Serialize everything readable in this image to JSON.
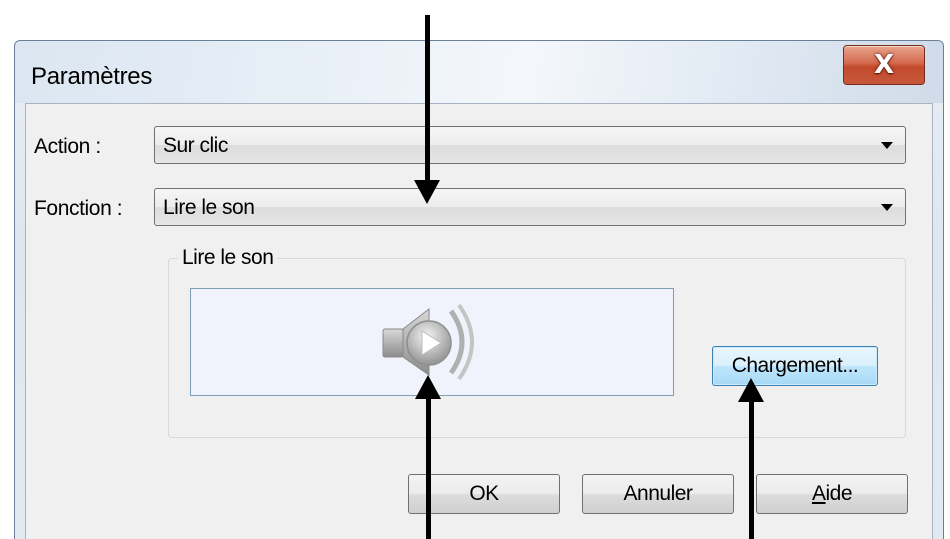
{
  "dialog": {
    "title": "Paramètres",
    "close_label": "X"
  },
  "form": {
    "action_label": "Action :",
    "action_value": "Sur clic",
    "fonction_label": "Fonction :",
    "fonction_value": "Lire le son"
  },
  "sound_group": {
    "title": "Lire le son",
    "load_button": "Chargement..."
  },
  "buttons": {
    "ok": "OK",
    "cancel": "Annuler",
    "help": "Aide"
  },
  "icons": {
    "sound_preview": "speaker-play-icon"
  }
}
